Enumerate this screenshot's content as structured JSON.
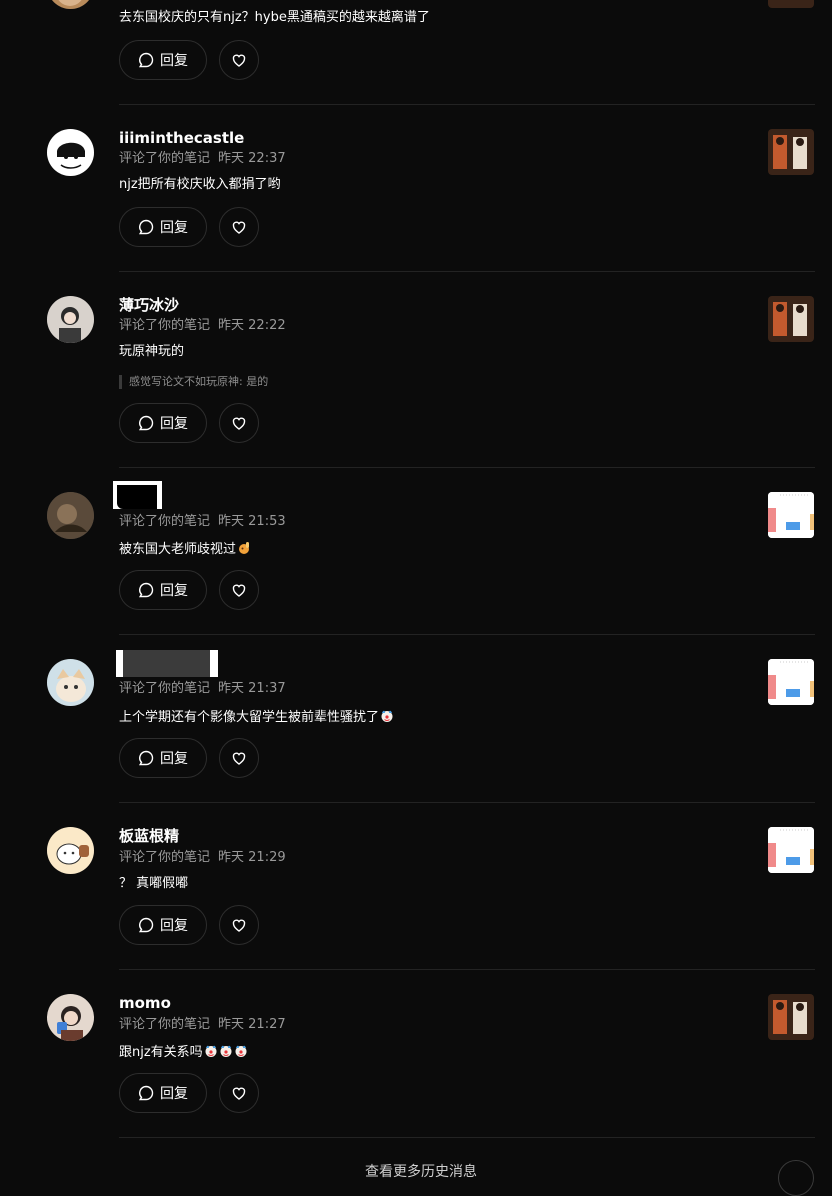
{
  "labels": {
    "reply": "回复",
    "commented": "评论了你的笔记",
    "bottom_link": "查看更多历史消息"
  },
  "icons": {
    "reply": "chat-bubble-icon",
    "like": "heart-icon",
    "emoji_a": "raising-hand-emoji",
    "emoji_b": "clown-face-emoji"
  },
  "first_item": {
    "text": "去东国校庆的只有njz？hybe黑通稿买的越来越离谱了"
  },
  "comments": [
    {
      "username": "iiiminthecastle",
      "time": "昨天 22:37",
      "text": "njz把所有校庆收入都捐了哟"
    },
    {
      "username": "薄巧冰沙",
      "time": "昨天 22:22",
      "text": "玩原神玩的",
      "quote": "感觉写论文不如玩原神: 是的"
    },
    {
      "username": "",
      "time": "昨天 21:53",
      "text": "被东国大老师歧视过"
    },
    {
      "username": "",
      "time": "昨天 21:37",
      "text": "上个学期还有个影像大留学生被前辈性骚扰了"
    },
    {
      "username": "板蓝根精",
      "time": "昨天 21:29",
      "text": "？ 真嘟假嘟"
    },
    {
      "username": "momo",
      "time": "昨天 21:27",
      "text": "跟njz有关系吗"
    }
  ],
  "colors": {
    "background": "#0b0b0b",
    "meta": "#9a9a9a",
    "border": "#2d2d2d"
  }
}
